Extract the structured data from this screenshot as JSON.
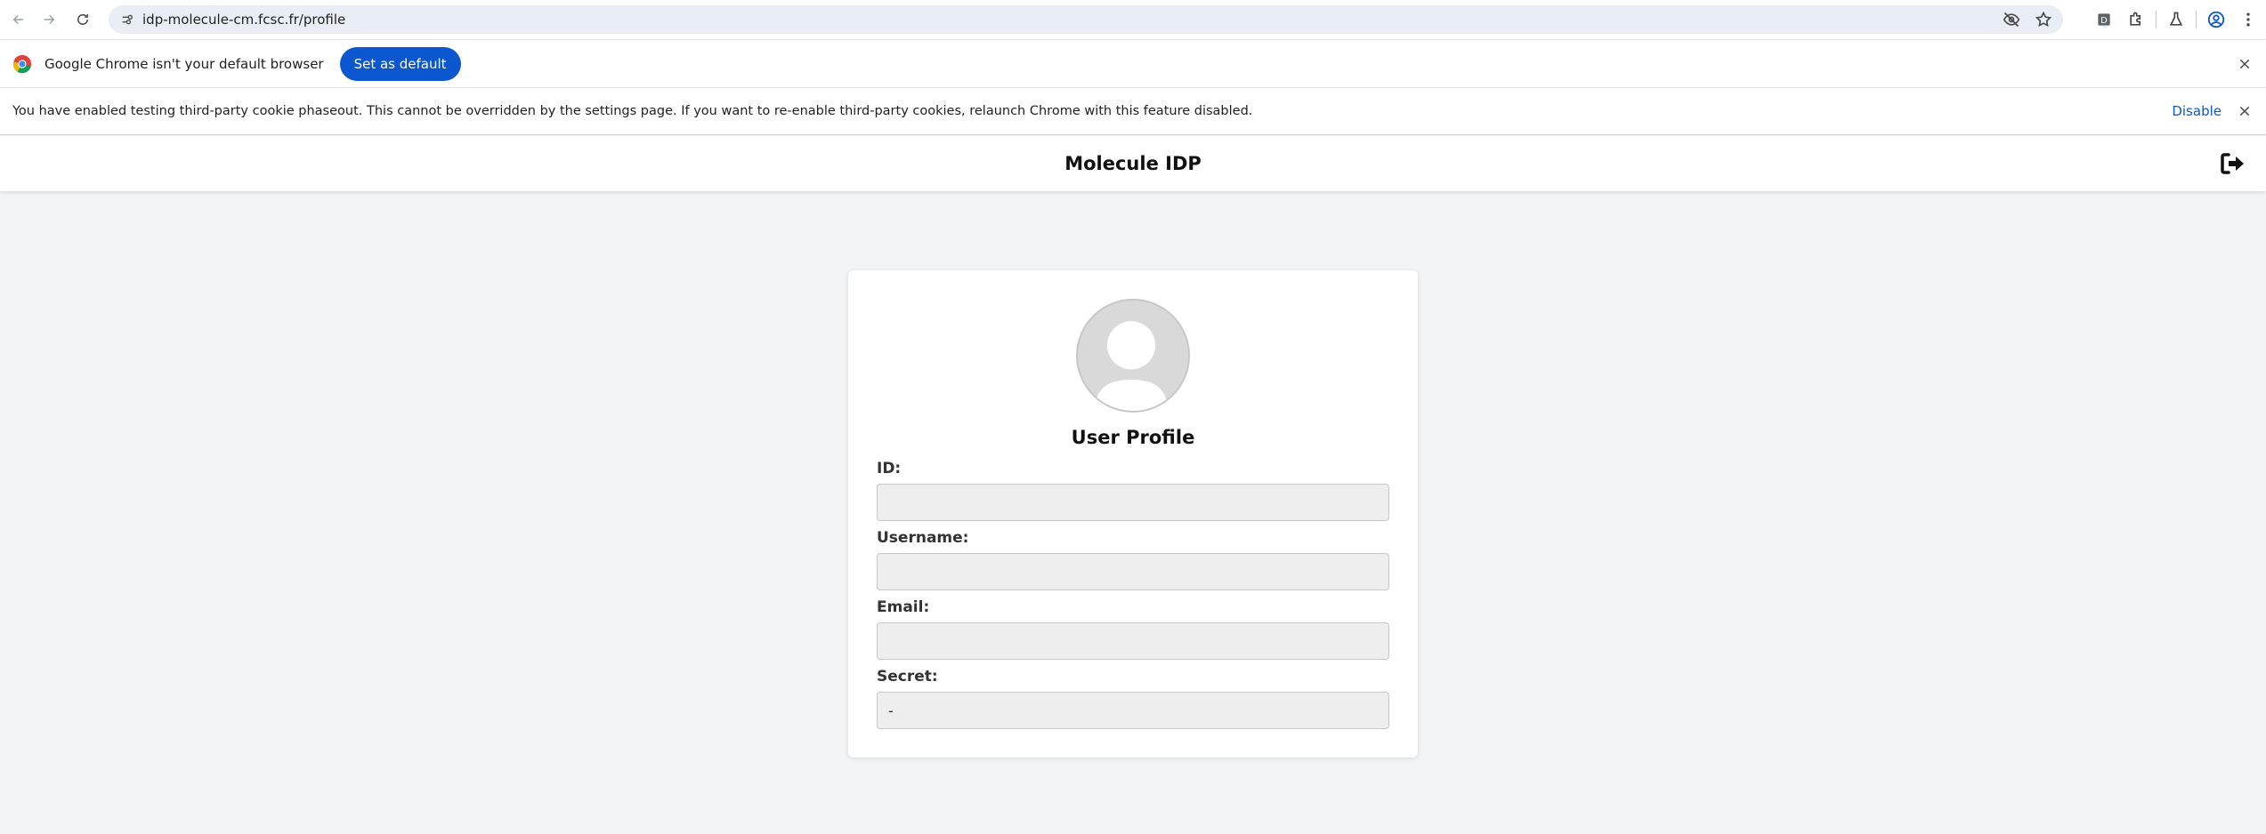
{
  "browser": {
    "url": "idp-molecule-cm.fcsc.fr/profile",
    "icons": [
      "back-icon",
      "forward-icon",
      "reload-icon",
      "site-settings-icon",
      "eye-off-icon",
      "star-icon",
      "extension-d-icon",
      "puzzle-icon",
      "flask-icon",
      "profile-icon",
      "menu-dots-icon"
    ]
  },
  "infobar_default": {
    "message": "Google Chrome isn't your default browser",
    "button": "Set as default"
  },
  "infobar_cookies": {
    "message": "You have enabled testing third-party cookie phaseout. This cannot be overridden by the settings page. If you want to re-enable third-party cookies, relaunch Chrome with this feature disabled.",
    "link": "Disable"
  },
  "app": {
    "title": "Molecule IDP",
    "logout_icon": "sign-out-icon"
  },
  "profile": {
    "title": "User Profile",
    "fields": [
      {
        "label": "ID:",
        "value": ""
      },
      {
        "label": "Username:",
        "value": ""
      },
      {
        "label": "Email:",
        "value": ""
      },
      {
        "label": "Secret:",
        "value": "-"
      }
    ]
  },
  "colors": {
    "accent": "#0b57d0",
    "page_bg": "#f3f4f6",
    "input_bg": "#eeeeee"
  }
}
